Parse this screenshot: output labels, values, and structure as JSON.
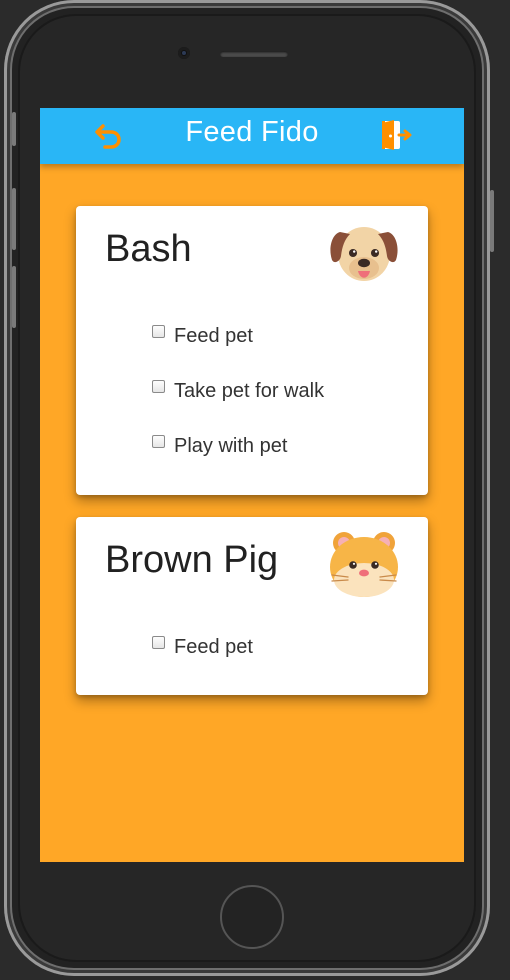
{
  "app_bar": {
    "title": "Feed Fido",
    "back_icon": "undo-arrow-icon",
    "logout_icon": "exit-door-icon",
    "colors": {
      "bar": "#29b6f6",
      "background": "#ffa726",
      "icon_accent": "#ff8f00"
    }
  },
  "pets": [
    {
      "name": "Bash",
      "avatar": "dog-face-icon",
      "tasks": [
        {
          "label": "Feed pet",
          "checked": false
        },
        {
          "label": "Take pet for walk",
          "checked": false
        },
        {
          "label": "Play with pet",
          "checked": false
        }
      ]
    },
    {
      "name": "Brown Pig",
      "avatar": "hamster-face-icon",
      "tasks": [
        {
          "label": "Feed pet",
          "checked": false
        }
      ]
    }
  ]
}
